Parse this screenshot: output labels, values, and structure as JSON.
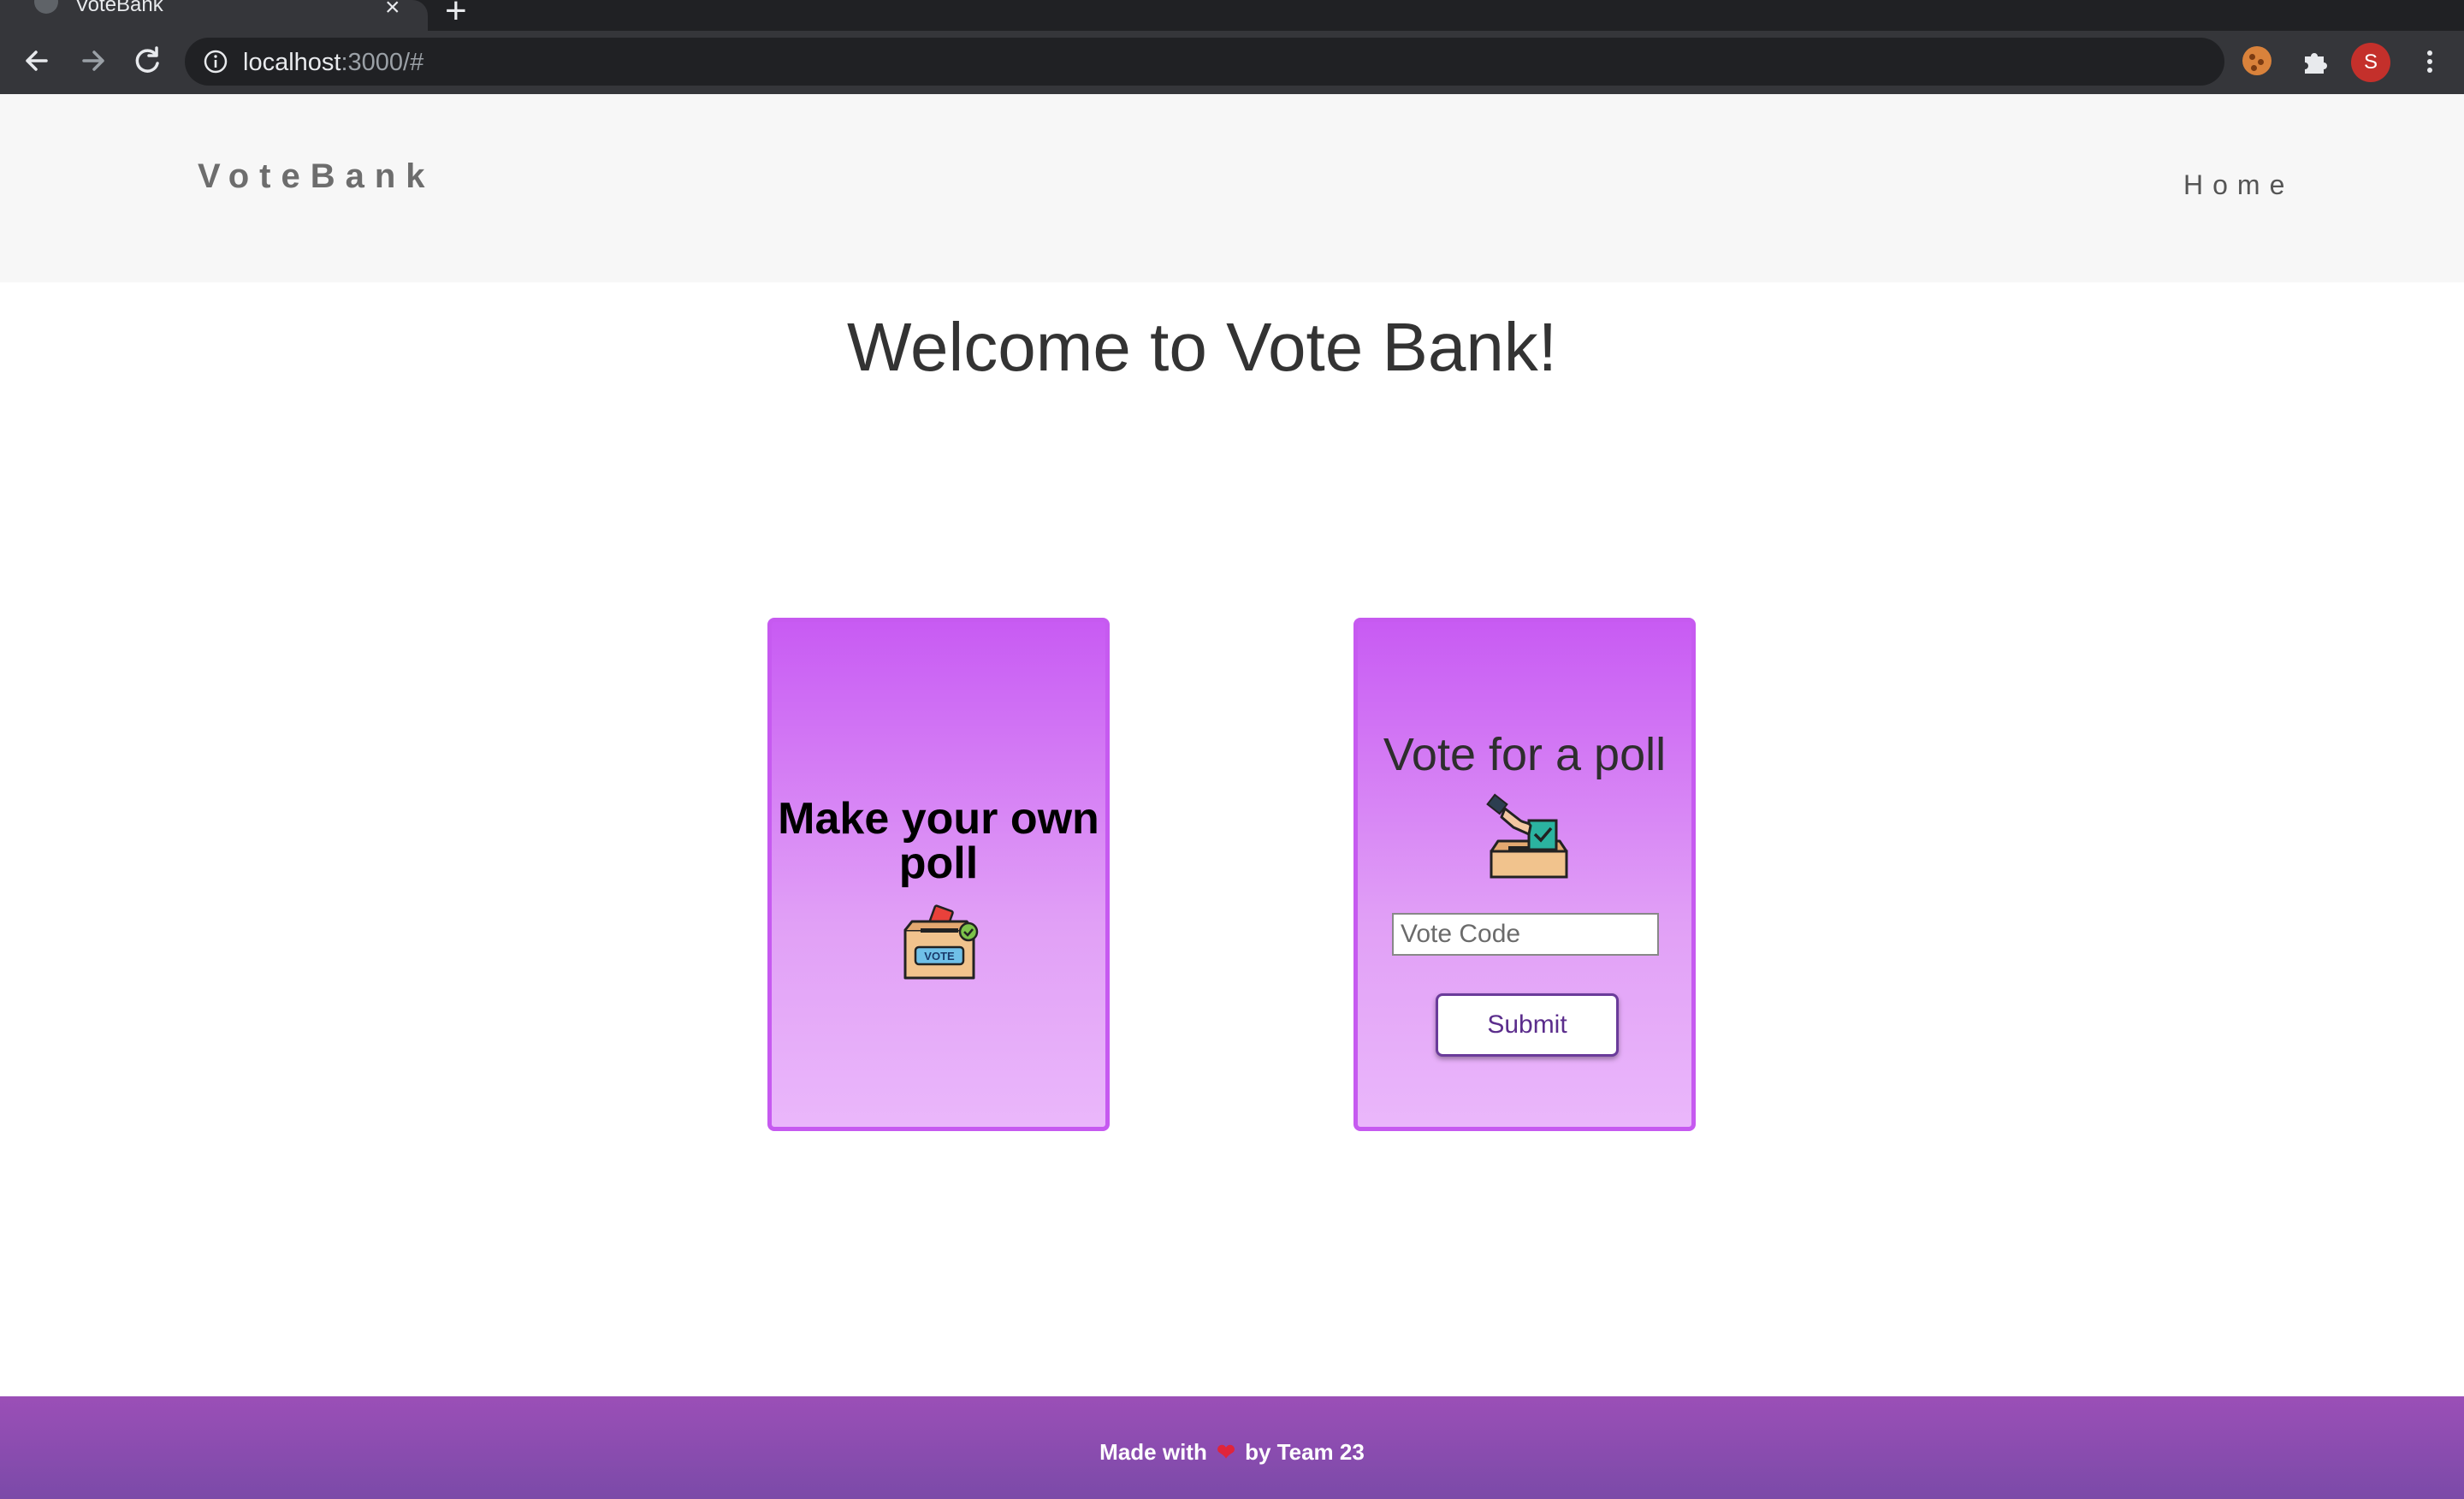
{
  "browser": {
    "tab_title": "VoteBank",
    "tab_close": "×",
    "new_tab": "+",
    "url_host": "localhost",
    "url_rest": ":3000/#",
    "profile_initial": "S"
  },
  "header": {
    "brand": "VoteBank",
    "nav_home": "Home"
  },
  "main": {
    "welcome": "Welcome to Vote Bank!",
    "make_card": {
      "title": "Make your own poll",
      "icon": "ballot-box-icon"
    },
    "vote_card": {
      "title": "Vote for a poll",
      "icon": "hand-ballot-icon",
      "input_placeholder": "Vote Code",
      "input_value": "",
      "submit_label": "Submit"
    }
  },
  "footer": {
    "made_with": "Made with",
    "heart": "❤",
    "by_team": "by Team 23"
  },
  "colors": {
    "card_top": "#c85bf3",
    "card_bottom": "#eab7fb",
    "footer": "#8e4eb3",
    "header_bg": "#f7f7f7"
  }
}
